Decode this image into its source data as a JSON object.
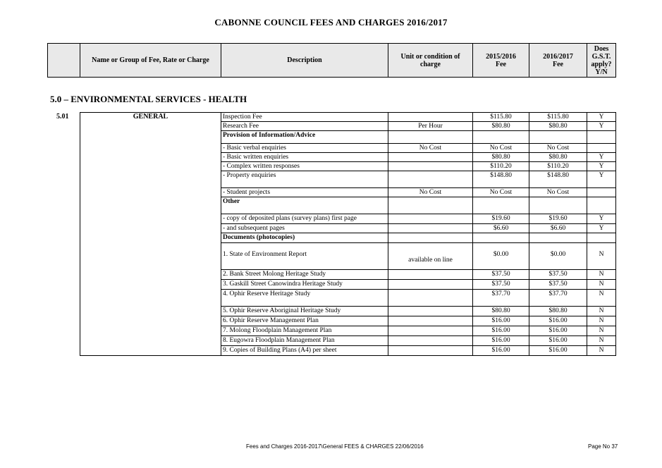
{
  "title": "CABONNE COUNCIL FEES AND CHARGES 2016/2017",
  "header": {
    "col_name": "Name or Group of Fee, Rate or Charge",
    "col_desc": "Description",
    "col_unit": "Unit or condition of charge",
    "col_fee1_a": "2015/2016",
    "col_fee1_b": "Fee",
    "col_fee2_a": "2016/2017",
    "col_fee2_b": "Fee",
    "col_gst_a": "Does",
    "col_gst_b": "G.S.T.",
    "col_gst_c": "apply?",
    "col_gst_d": "Y/N"
  },
  "section_title": "5.0 – ENVIRONMENTAL SERVICES - HEALTH",
  "item_number": "5.01",
  "group_name": "GENERAL",
  "rows": [
    {
      "desc": "Inspection Fee",
      "unit": "",
      "fee1": "$115.80",
      "fee2": "$115.80",
      "gst": "Y"
    },
    {
      "desc": "Research Fee",
      "unit": "Per Hour",
      "fee1": "$80.80",
      "fee2": "$80.80",
      "gst": "Y"
    },
    {
      "desc": "Provision of Information/Advice",
      "unit": "",
      "fee1": "",
      "fee2": "",
      "gst": ""
    },
    {
      "desc": "-     Basic verbal enquiries",
      "unit": "No Cost",
      "fee1": "No Cost",
      "fee2": "No Cost",
      "gst": ""
    },
    {
      "desc": "-     Basic written enquiries",
      "unit": "",
      "fee1": "$80.80",
      "fee2": "$80.80",
      "gst": "Y"
    },
    {
      "desc": "-     Complex written responses",
      "unit": "",
      "fee1": "$110.20",
      "fee2": "$110.20",
      "gst": "Y"
    },
    {
      "desc": "-     Property enquiries",
      "unit": "",
      "fee1": "$148.80",
      "fee2": "$148.80",
      "gst": "Y"
    },
    {
      "desc": "-     Student projects",
      "unit": "No Cost",
      "fee1": "No Cost",
      "fee2": "No Cost",
      "gst": ""
    },
    {
      "desc": "Other",
      "unit": "",
      "fee1": "",
      "fee2": "",
      "gst": ""
    },
    {
      "desc": "-     copy of deposited plans (survey plans) first page",
      "unit": "",
      "fee1": "$19.60",
      "fee2": "$19.60",
      "gst": "Y"
    },
    {
      "desc": "-     and subsequent pages",
      "unit": "",
      "fee1": "$6.60",
      "fee2": "$6.60",
      "gst": "Y"
    },
    {
      "desc": "Documents (photocopies)",
      "unit": "",
      "fee1": "",
      "fee2": "",
      "gst": ""
    },
    {
      "desc": "1.   State of Environment Report",
      "unit": "available on line",
      "fee1": "$0.00",
      "fee2": "$0.00",
      "gst": "N"
    },
    {
      "desc": "2.  Bank Street Molong Heritage Study",
      "unit": "",
      "fee1": "$37.50",
      "fee2": "$37.50",
      "gst": "N"
    },
    {
      "desc": "3.  Gaskill Street Canowindra Heritage Study",
      "unit": "",
      "fee1": "$37.50",
      "fee2": "$37.50",
      "gst": "N"
    },
    {
      "desc": "4.  Ophir Reserve Heritage Study",
      "unit": "",
      "fee1": "$37.70",
      "fee2": "$37.70",
      "gst": "N"
    },
    {
      "desc": "5.  Ophir Reserve Aboriginal Heritage Study",
      "unit": "",
      "fee1": "$80.80",
      "fee2": "$80.80",
      "gst": "N"
    },
    {
      "desc": "6.  Ophir Reserve Management Plan",
      "unit": "",
      "fee1": "$16.00",
      "fee2": "$16.00",
      "gst": "N"
    },
    {
      "desc": "7.  Molong Floodplain Management Plan",
      "unit": "",
      "fee1": "$16.00",
      "fee2": "$16.00",
      "gst": "N"
    },
    {
      "desc": "8.  Eugowra Floodplain Management Plan",
      "unit": "",
      "fee1": "$16.00",
      "fee2": "$16.00",
      "gst": "N"
    },
    {
      "desc": "9.  Copies of Building Plans (A4) per sheet",
      "unit": "",
      "fee1": "$16.00",
      "fee2": "$16.00",
      "gst": "N"
    }
  ],
  "footer": {
    "left": "Fees and Charges 2016-2017\\General FEES & CHARGES 22/06/2016",
    "right": "Page No 37"
  }
}
